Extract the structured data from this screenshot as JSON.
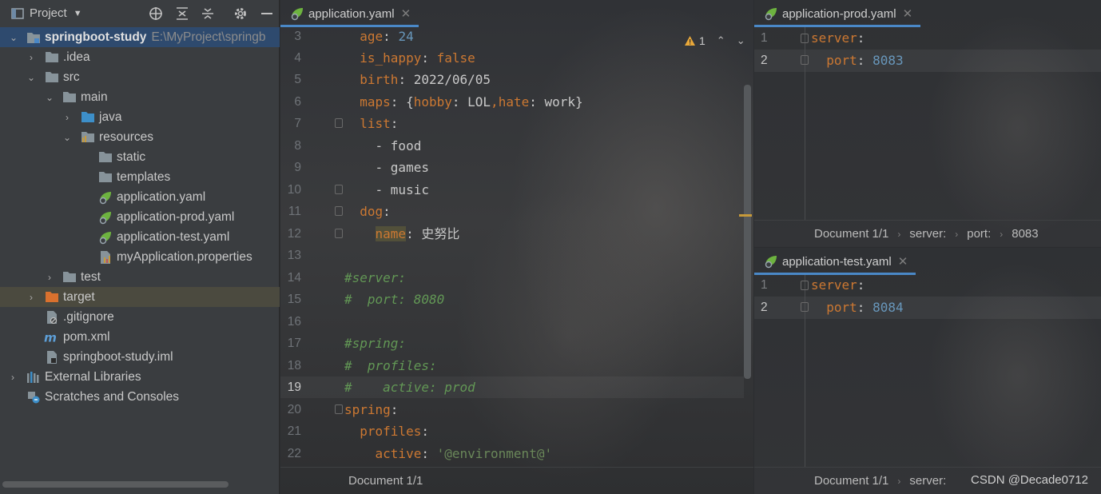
{
  "project_panel": {
    "title": "Project",
    "tree": [
      {
        "label": "springboot-study",
        "path": "E:\\MyProject\\springb",
        "bold": true
      },
      {
        "label": ".idea"
      },
      {
        "label": "src"
      },
      {
        "label": "main"
      },
      {
        "label": "java"
      },
      {
        "label": "resources"
      },
      {
        "label": "static"
      },
      {
        "label": "templates"
      },
      {
        "label": "application.yaml"
      },
      {
        "label": "application-prod.yaml"
      },
      {
        "label": "application-test.yaml"
      },
      {
        "label": "myApplication.properties"
      },
      {
        "label": "test"
      },
      {
        "label": "target"
      },
      {
        "label": ".gitignore"
      },
      {
        "label": "pom.xml"
      },
      {
        "label": "springboot-study.iml"
      },
      {
        "label": "External Libraries"
      },
      {
        "label": "Scratches and Consoles"
      }
    ]
  },
  "main_editor": {
    "tab": "application.yaml",
    "inspection_count": "1",
    "line_numbers": [
      "3",
      "4",
      "5",
      "6",
      "7",
      "8",
      "9",
      "10",
      "11",
      "12",
      "13",
      "14",
      "15",
      "16",
      "17",
      "18",
      "19",
      "20",
      "21",
      "22"
    ],
    "current_line": "19",
    "code": {
      "l3_key": "age",
      "l3_val": "24",
      "l4_key": "is_happy",
      "l4_val": "false",
      "l5_key": "birth",
      "l5_val": "2022/06/05",
      "l6_key": "maps",
      "l6_k1": "hobby",
      "l6_v1": "LOL",
      "l6_k2": "hate",
      "l6_v2": "work",
      "l7_key": "list",
      "l8_val": "food",
      "l9_val": "games",
      "l10_val": "music",
      "l11_key": "dog",
      "l12_key": "name",
      "l12_val": "史努比",
      "l14_comment": "#server:",
      "l15_comment": "#  port: 8080",
      "l17_comment": "#spring:",
      "l18_comment": "#  profiles:",
      "l19_comment": "#    active: prod",
      "l20_key": "spring",
      "l21_key": "profiles",
      "l22_key": "active",
      "l22_val": "'@environment@'"
    },
    "breadcrumb": "Document 1/1"
  },
  "prod_editor": {
    "tab": "application-prod.yaml",
    "line_numbers": [
      "1",
      "2"
    ],
    "l1_key": "server",
    "l2_key": "port",
    "l2_val": "8083",
    "breadcrumb": [
      "Document 1/1",
      "server:",
      "port:",
      "8083"
    ]
  },
  "test_editor": {
    "tab": "application-test.yaml",
    "line_numbers": [
      "1",
      "2"
    ],
    "l1_key": "server",
    "l2_key": "port",
    "l2_val": "8084",
    "breadcrumb": [
      "Document 1/1",
      "server:"
    ]
  },
  "watermark": "CSDN @Decade0712",
  "colors": {
    "keyword": "#cc7832",
    "string": "#6a8759",
    "number": "#6897bb",
    "comment": "#629755",
    "selection": "#2e4a6e",
    "tab_underline": "#4a88c7"
  }
}
